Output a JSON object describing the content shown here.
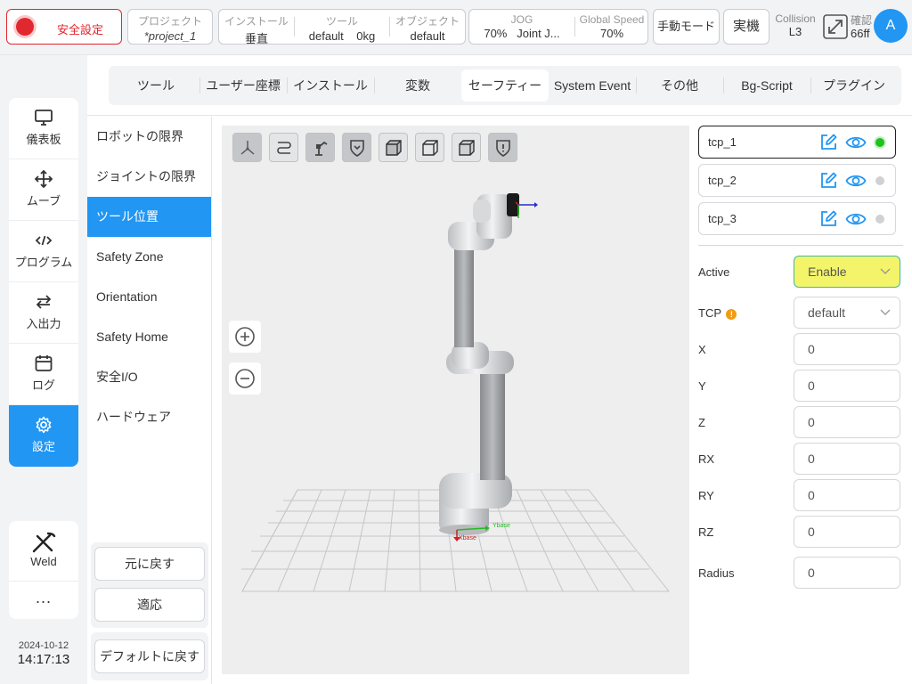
{
  "header": {
    "safety_label": "安全設定",
    "project": {
      "label": "プロジェクト",
      "value": "*project_1"
    },
    "install": {
      "label": "インストール",
      "value": "垂直"
    },
    "tool": {
      "label": "ツール",
      "name": "default",
      "weight": "0kg"
    },
    "object": {
      "label": "オブジェクト",
      "value": "default"
    },
    "jog": {
      "label": "JOG",
      "speed": "70%",
      "mode": "Joint J..."
    },
    "global_speed": {
      "label": "Global Speed",
      "value": "70%"
    },
    "mode_button": "手動モード",
    "real_button": "実機",
    "collision": {
      "label": "Collision",
      "value": "L3"
    },
    "confirm": {
      "label": "確認",
      "value": "66ff"
    },
    "avatar": "A"
  },
  "nav": {
    "items": [
      {
        "label": "儀表板",
        "icon": "monitor-icon"
      },
      {
        "label": "ムーブ",
        "icon": "move-arrows-icon"
      },
      {
        "label": "プログラム",
        "icon": "code-icon"
      },
      {
        "label": "入出力",
        "icon": "swap-arrows-icon"
      },
      {
        "label": "ログ",
        "icon": "calendar-icon"
      },
      {
        "label": "設定",
        "icon": "gear-icon"
      }
    ],
    "weld": "Weld",
    "more": "...",
    "date": "2024-10-12",
    "time": "14:17:13"
  },
  "tabs": [
    "ツール",
    "ユーザー座標",
    "インストール",
    "変数",
    "セーフティー",
    "System Event",
    "その他",
    "Bg-Script",
    "プラグイン"
  ],
  "active_tab": "セーフティー",
  "submenu": {
    "items": [
      "ロボットの限界",
      "ジョイントの限界",
      "ツール位置",
      "Safety Zone",
      "Orientation",
      "Safety Home",
      "安全I/O",
      "ハードウェア"
    ],
    "active": "ツール位置",
    "revert": "元に戻す",
    "apply": "適応",
    "default": "デフォルトに戻す"
  },
  "viewport": {
    "toolbar": [
      "axes-view-icon",
      "path-icon",
      "robot-arm-icon",
      "shield-icon",
      "cube-front-icon",
      "cube-back-icon",
      "cube-side-icon",
      "shield-alert-icon"
    ],
    "axis_labels": {
      "x": "Xbase",
      "y": "Ybase"
    }
  },
  "tcp_list": [
    {
      "name": "tcp_1",
      "active": true
    },
    {
      "name": "tcp_2",
      "active": false
    },
    {
      "name": "tcp_3",
      "active": false
    }
  ],
  "form": {
    "active": {
      "label": "Active",
      "value": "Enable"
    },
    "tcp": {
      "label": "TCP",
      "value": "default"
    },
    "x": {
      "label": "X",
      "value": "0"
    },
    "y": {
      "label": "Y",
      "value": "0"
    },
    "z": {
      "label": "Z",
      "value": "0"
    },
    "rx": {
      "label": "RX",
      "value": "0"
    },
    "ry": {
      "label": "RY",
      "value": "0"
    },
    "rz": {
      "label": "RZ",
      "value": "0"
    },
    "radius": {
      "label": "Radius",
      "value": "0"
    }
  },
  "colors": {
    "accent": "#2196f3",
    "danger": "#e0282e",
    "highlight": "#f4f46a",
    "ok": "#1fc01f"
  }
}
